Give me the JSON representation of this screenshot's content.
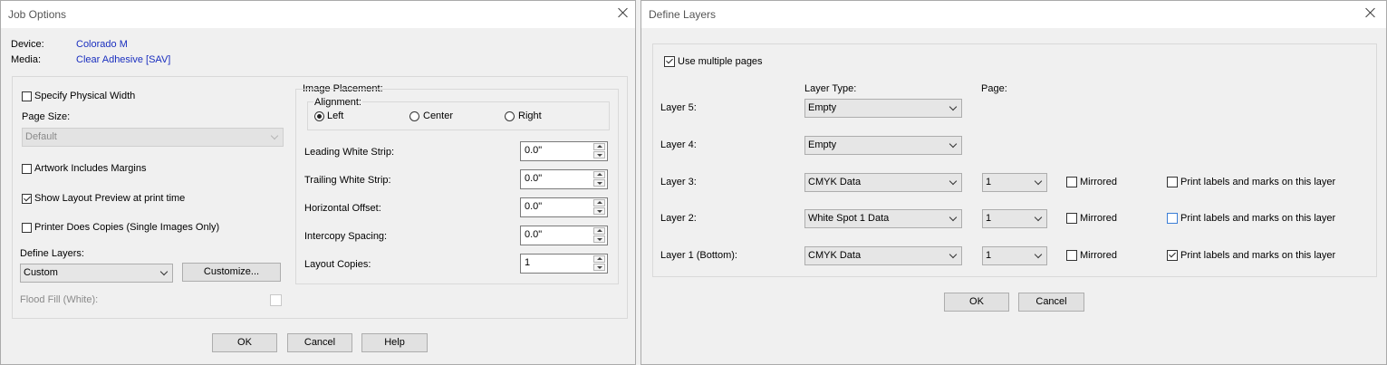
{
  "job_options": {
    "title": "Job Options",
    "device_label": "Device:",
    "device_value": "Colorado M",
    "media_label": "Media:",
    "media_value": "Clear Adhesive [SAV]",
    "specify_physical_width": "Specify Physical Width",
    "page_size_label": "Page Size:",
    "page_size_value": "Default",
    "artwork_includes_margins": "Artwork Includes Margins",
    "show_layout_preview": "Show Layout Preview at print time",
    "printer_does_copies": "Printer Does Copies (Single Images Only)",
    "define_layers_label": "Define Layers:",
    "define_layers_value": "Custom",
    "customize_button": "Customize...",
    "flood_fill_label": "Flood Fill (White):",
    "image_placement_label": "Image Placement:",
    "alignment_label": "Alignment:",
    "align_left": "Left",
    "align_center": "Center",
    "align_right": "Right",
    "leading_white_strip_label": "Leading White Strip:",
    "leading_white_strip_value": "0.0\"",
    "trailing_white_strip_label": "Trailing White Strip:",
    "trailing_white_strip_value": "0.0\"",
    "horizontal_offset_label": "Horizontal Offset:",
    "horizontal_offset_value": "0.0\"",
    "intercopy_spacing_label": "Intercopy Spacing:",
    "intercopy_spacing_value": "0.0\"",
    "layout_copies_label": "Layout Copies:",
    "layout_copies_value": "1",
    "ok_button": "OK",
    "cancel_button": "Cancel",
    "help_button": "Help",
    "checked": {
      "specify_physical_width": false,
      "artwork_includes_margins": false,
      "show_layout_preview": true,
      "printer_does_copies": false,
      "flood_fill": false
    },
    "alignment_selected": "Left"
  },
  "define_layers": {
    "title": "Define Layers",
    "use_multiple_pages": "Use multiple pages",
    "use_multiple_pages_checked": true,
    "layer_type_header": "Layer Type:",
    "page_header": "Page:",
    "mirrored_label": "Mirrored",
    "print_labels_label": "Print labels and marks on this layer",
    "layers": [
      {
        "name": "Layer 5:",
        "type": "Empty"
      },
      {
        "name": "Layer 4:",
        "type": "Empty"
      },
      {
        "name": "Layer 3:",
        "type": "CMYK Data",
        "page": "1",
        "mirrored": false,
        "print_labels": false
      },
      {
        "name": "Layer 2:",
        "type": "White Spot 1 Data",
        "page": "1",
        "mirrored": false,
        "print_labels": false
      },
      {
        "name": "Layer 1 (Bottom):",
        "type": "CMYK Data",
        "page": "1",
        "mirrored": false,
        "print_labels": true
      }
    ],
    "ok_button": "OK",
    "cancel_button": "Cancel"
  },
  "icons": {
    "close": "close-icon",
    "dropdown": "chevron-down-icon",
    "spin_up": "spin-up-icon",
    "spin_down": "spin-down-icon"
  },
  "colors": {
    "link_text": "#1a2fbf",
    "dialog_bg": "#f0f0f0",
    "titlebar_bg": "#ffffff"
  }
}
